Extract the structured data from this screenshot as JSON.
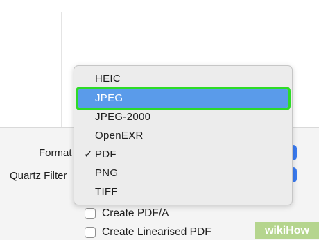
{
  "options": {
    "format_label": "Format",
    "quartz_label": "Quartz Filter",
    "checkboxes": [
      {
        "label": "Create PDF/A",
        "checked": false
      },
      {
        "label": "Create Linearised PDF",
        "checked": false
      }
    ]
  },
  "format_menu": {
    "items": [
      "HEIC",
      "JPEG",
      "JPEG-2000",
      "OpenEXR",
      "PDF",
      "PNG",
      "TIFF"
    ],
    "checked_item": "PDF",
    "highlighted_item": "JPEG",
    "check_glyph": "✓"
  },
  "colors": {
    "highlight": "#5a9bea",
    "highlight_outline": "#2edb27",
    "stepper": "#3a7bf0"
  },
  "watermark": {
    "prefix": "wiki",
    "suffix": "How"
  }
}
